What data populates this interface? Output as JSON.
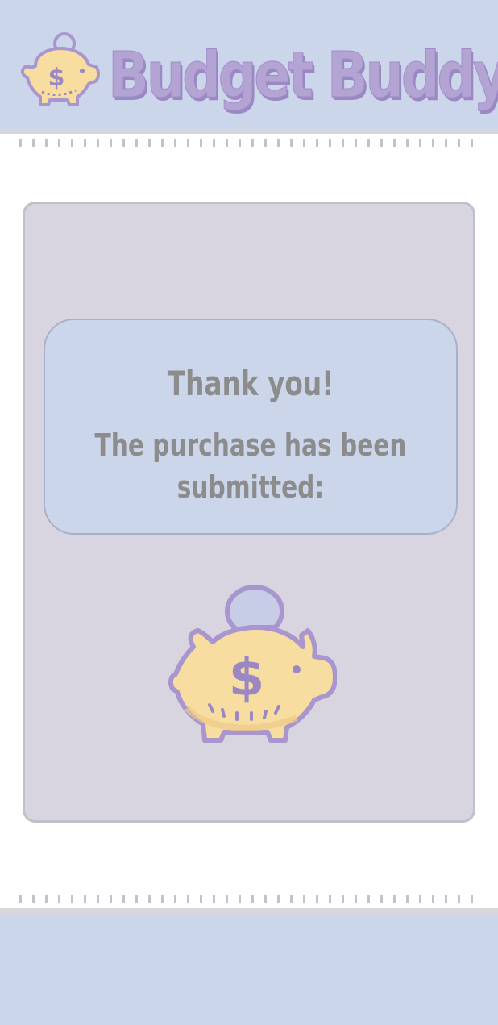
{
  "header": {
    "brand_name": "Budget Buddy",
    "logo_icon": "piggy-bank-icon"
  },
  "confirmation": {
    "title": "Thank you!",
    "message": "The purchase has been submitted:",
    "icon": "piggy-bank-coin-icon"
  },
  "colors": {
    "header_bg": "#cbd6eb",
    "brand_text": "#b3a4d4",
    "card_bg": "#d8d5e0",
    "message_bg": "#cbd6eb",
    "message_text": "#8c8c8c",
    "pig_body": "#f7dda0",
    "pig_outline": "#a996cf"
  }
}
